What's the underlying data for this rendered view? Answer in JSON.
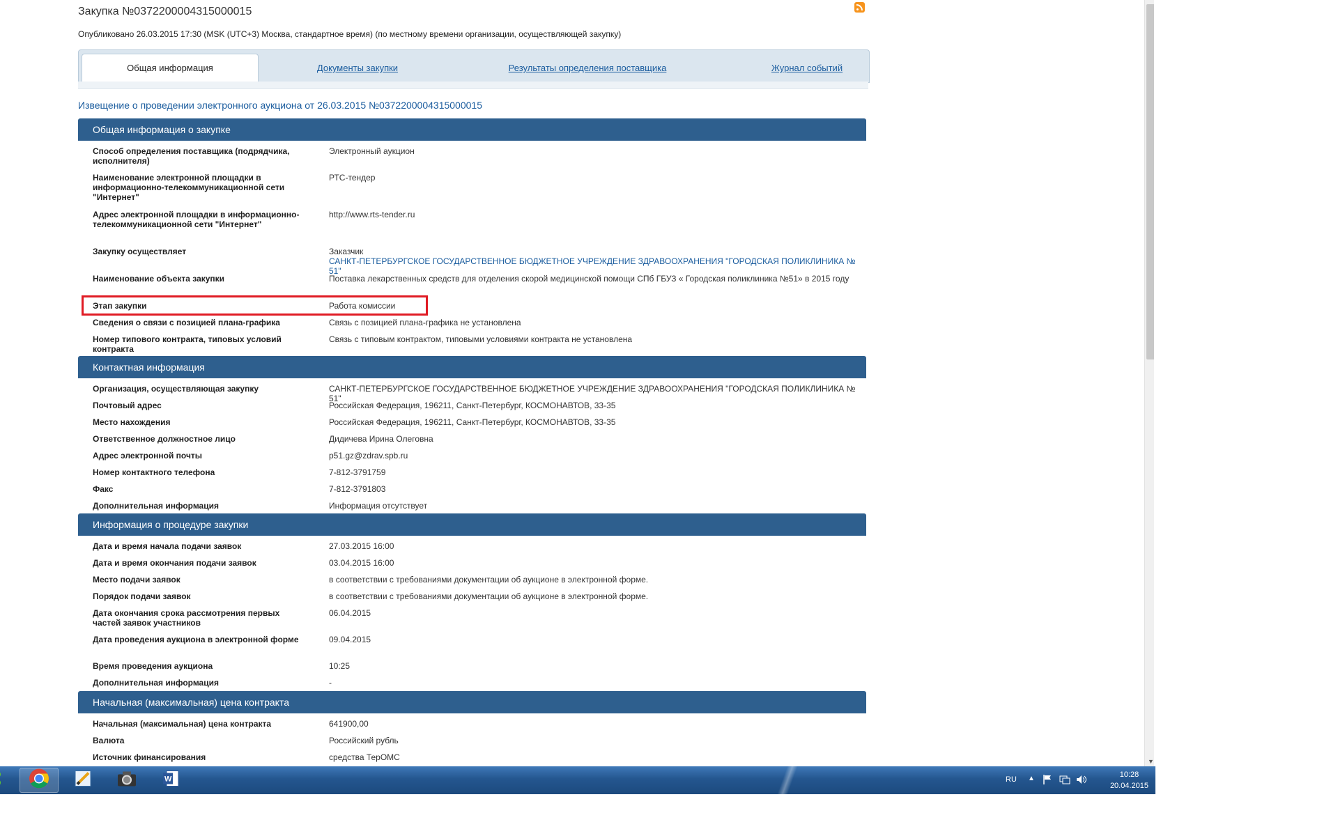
{
  "page": {
    "title": "Закупка №0372200004315000015",
    "published": "Опубликовано 26.03.2015 17:30 (MSK (UTC+3) Москва, стандартное время) (по местному времени организации, осуществляющей закупку)",
    "notice_link": "Извещение о проведении электронного аукциона от 26.03.2015 №0372200004315000015"
  },
  "tabs": [
    {
      "label": "Общая информация",
      "active": true
    },
    {
      "label": "Документы закупки",
      "active": false
    },
    {
      "label": "Результаты определения поставщика",
      "active": false
    },
    {
      "label": "Журнал событий",
      "active": false
    }
  ],
  "sections": {
    "general": {
      "title": "Общая информация о закупке",
      "rows": [
        {
          "label": "Способ определения поставщика (подрядчика, исполнителя)",
          "value": "Электронный аукцион"
        },
        {
          "label": "Наименование электронной площадки в информационно-телекоммуникационной сети \"Интернет\"",
          "value": "РТС-тендер"
        },
        {
          "label": "Адрес электронной площадки в информационно-телекоммуникационной сети \"Интернет\"",
          "value": "http://www.rts-tender.ru"
        },
        {
          "label": "Закупку осуществляет",
          "value": "Заказчик",
          "value_link": "САНКТ-ПЕТЕРБУРГСКОЕ ГОСУДАРСТВЕННОЕ БЮДЖЕТНОЕ УЧРЕЖДЕНИЕ ЗДРАВООХРАНЕНИЯ \"ГОРОДСКАЯ ПОЛИКЛИНИКА № 51\""
        },
        {
          "label": "Наименование объекта закупки",
          "value": "Поставка лекарственных средств для отделения скорой медицинской помощи СПб ГБУЗ « Городская поликлиника №51» в 2015 году"
        },
        {
          "label": "Этап закупки",
          "value": "Работа комиссии"
        },
        {
          "label": "Сведения о связи с позицией плана-графика",
          "value": "Связь с позицией плана-графика не установлена"
        },
        {
          "label": "Номер типового контракта, типовых условий контракта",
          "value": "Связь с типовым контрактом, типовыми условиями контракта не установлена"
        }
      ]
    },
    "contact": {
      "title": "Контактная информация",
      "rows": [
        {
          "label": "Организация, осуществляющая закупку",
          "value": "САНКТ-ПЕТЕРБУРГСКОЕ ГОСУДАРСТВЕННОЕ БЮДЖЕТНОЕ УЧРЕЖДЕНИЕ ЗДРАВООХРАНЕНИЯ \"ГОРОДСКАЯ ПОЛИКЛИНИКА № 51\""
        },
        {
          "label": "Почтовый адрес",
          "value": "Российская Федерация, 196211, Санкт-Петербург, КОСМОНАВТОВ, 33-35"
        },
        {
          "label": "Место нахождения",
          "value": "Российская Федерация, 196211, Санкт-Петербург, КОСМОНАВТОВ, 33-35"
        },
        {
          "label": "Ответственное должностное лицо",
          "value": "Дидичева Ирина Олеговна"
        },
        {
          "label": "Адрес электронной почты",
          "value": "p51.gz@zdrav.spb.ru"
        },
        {
          "label": "Номер контактного телефона",
          "value": "7-812-3791759"
        },
        {
          "label": "Факс",
          "value": "7-812-3791803"
        },
        {
          "label": "Дополнительная информация",
          "value": "Информация отсутствует"
        }
      ]
    },
    "procedure": {
      "title": "Информация о процедуре закупки",
      "rows": [
        {
          "label": "Дата и время начала подачи заявок",
          "value": "27.03.2015 16:00"
        },
        {
          "label": "Дата и время окончания подачи заявок",
          "value": "03.04.2015 16:00"
        },
        {
          "label": "Место подачи заявок",
          "value": "в соответствии с требованиями документации об аукционе в электронной форме."
        },
        {
          "label": "Порядок подачи заявок",
          "value": "в соответствии с требованиями документации об аукционе в электронной форме."
        },
        {
          "label": "Дата окончания срока рассмотрения первых частей заявок участников",
          "value": "06.04.2015"
        },
        {
          "label": "Дата проведения аукциона в электронной форме",
          "value": "09.04.2015"
        },
        {
          "label": "Время проведения аукциона",
          "value": "10:25"
        },
        {
          "label": "Дополнительная информация",
          "value": "-"
        }
      ]
    },
    "price": {
      "title": "Начальная (максимальная) цена контракта",
      "rows": [
        {
          "label": "Начальная (максимальная) цена контракта",
          "value": "641900,00"
        },
        {
          "label": "Валюта",
          "value": "Российский рубль"
        },
        {
          "label": "Источник финансирования",
          "value": "средства ТерОМС"
        }
      ]
    }
  },
  "taskbar": {
    "apps": [
      {
        "icon": "chrome-icon",
        "active": true
      },
      {
        "icon": "paint-icon",
        "active": false
      },
      {
        "icon": "camera-icon",
        "active": false
      },
      {
        "icon": "word-icon",
        "active": false
      }
    ],
    "language": "RU",
    "time": "10:28",
    "date": "20.04.2015"
  },
  "colors": {
    "section_header": "#2e5f8e",
    "link": "#1a5c9e",
    "highlight": "#e01b24",
    "taskbar": "#24568f"
  }
}
